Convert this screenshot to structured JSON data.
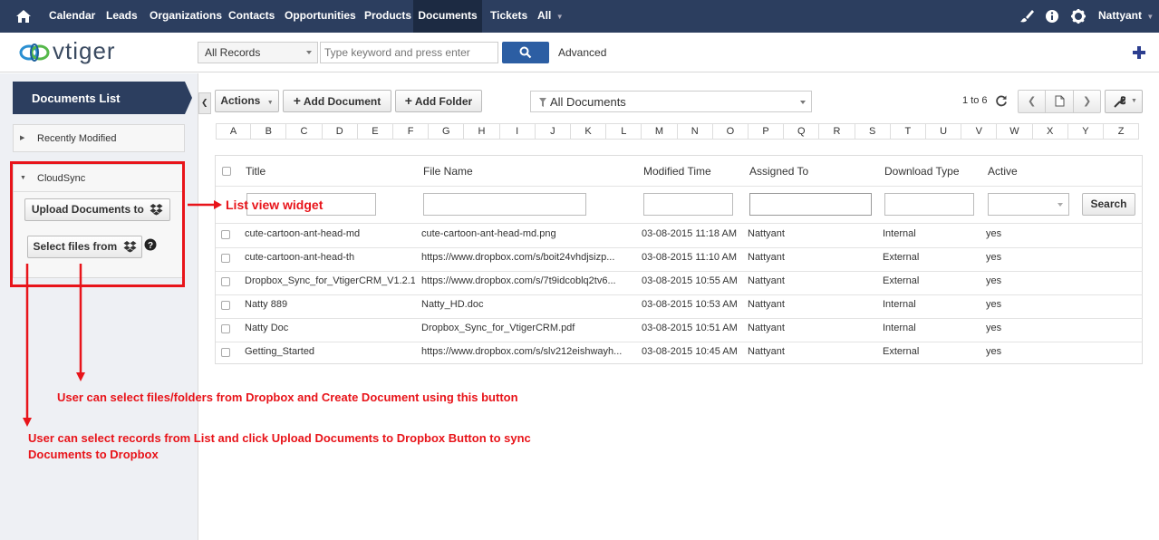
{
  "nav": {
    "items": [
      "Calendar",
      "Leads",
      "Organizations",
      "Contacts",
      "Opportunities",
      "Products",
      "Documents",
      "Tickets",
      "All"
    ],
    "active": "Documents",
    "user": "Nattyant"
  },
  "subbar": {
    "logo_text": "vtiger",
    "record_select": "All Records",
    "search_placeholder": "Type keyword and press enter",
    "advanced": "Advanced"
  },
  "sidebar": {
    "title": "Documents List",
    "recently_modified": "Recently Modified",
    "cloudsync": "CloudSync",
    "upload_btn": "Upload Documents to",
    "select_btn": "Select files from"
  },
  "toolbar": {
    "actions": "Actions",
    "add_document": "Add Document",
    "add_folder": "Add Folder",
    "filter": "All Documents",
    "pagination": "1 to 6"
  },
  "alphabet": [
    "A",
    "B",
    "C",
    "D",
    "E",
    "F",
    "G",
    "H",
    "I",
    "J",
    "K",
    "L",
    "M",
    "N",
    "O",
    "P",
    "Q",
    "R",
    "S",
    "T",
    "U",
    "V",
    "W",
    "X",
    "Y",
    "Z"
  ],
  "table": {
    "columns": [
      "Title",
      "File Name",
      "Modified Time",
      "Assigned To",
      "Download Type",
      "Active"
    ],
    "search_btn": "Search",
    "rows": [
      [
        "cute-cartoon-ant-head-md",
        "cute-cartoon-ant-head-md.png",
        "03-08-2015 11:18 AM",
        "Nattyant",
        "Internal",
        "yes"
      ],
      [
        "cute-cartoon-ant-head-th",
        "https://www.dropbox.com/s/boit24vhdjsizp...",
        "03-08-2015 11:10 AM",
        "Nattyant",
        "External",
        "yes"
      ],
      [
        "Dropbox_Sync_for_VtigerCRM_V1.2.1",
        "https://www.dropbox.com/s/7t9idcoblq2tv6...",
        "03-08-2015 10:55 AM",
        "Nattyant",
        "External",
        "yes"
      ],
      [
        "Natty 889",
        "Natty_HD.doc",
        "03-08-2015 10:53 AM",
        "Nattyant",
        "Internal",
        "yes"
      ],
      [
        "Natty Doc",
        "Dropbox_Sync_for_VtigerCRM.pdf",
        "03-08-2015 10:51 AM",
        "Nattyant",
        "Internal",
        "yes"
      ],
      [
        "Getting_Started",
        "https://www.dropbox.com/s/slv212eishwayh...",
        "03-08-2015 10:45 AM",
        "Nattyant",
        "External",
        "yes"
      ]
    ]
  },
  "annotations": {
    "list_view_widget": "List view widget",
    "select_files_note": "User can select files/folders from Dropbox and Create Document using this button",
    "upload_note_line1": "User can select records from List and click Upload Documents to Dropbox Button to sync",
    "upload_note_line2": "Documents to Dropbox"
  },
  "colors": {
    "nav_bg": "#2c3e5f",
    "accent": "#2c3e5f",
    "annotation": "#e8141a"
  }
}
